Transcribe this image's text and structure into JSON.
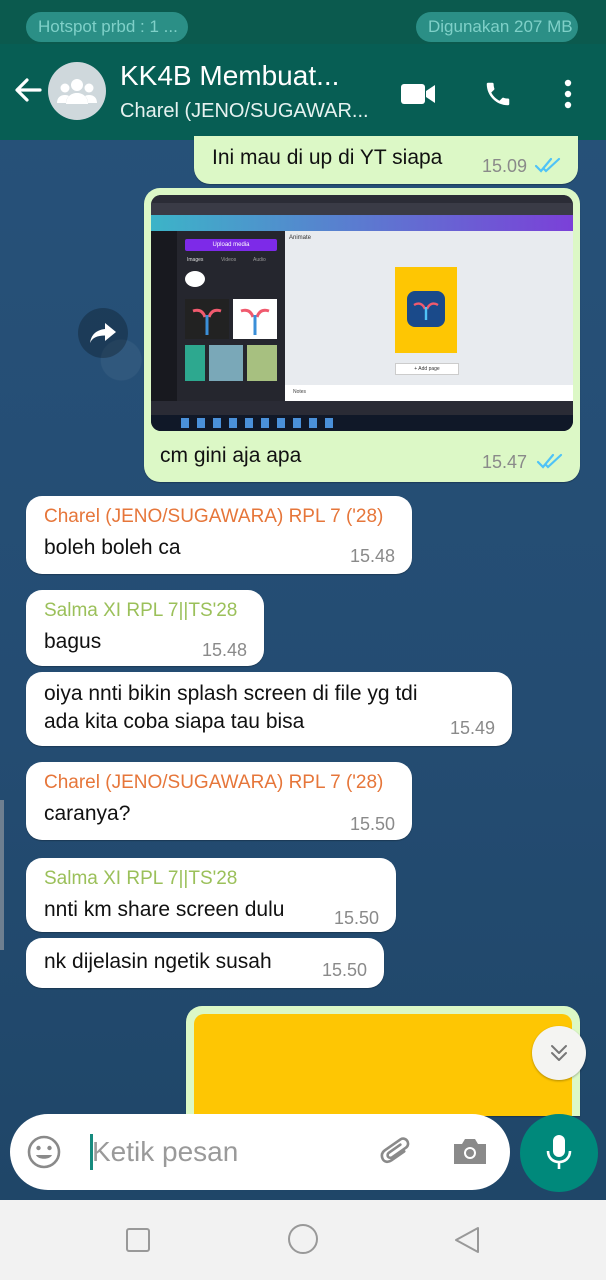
{
  "status": {
    "hotspot": "Hotspot prbd : 1 ...",
    "usage": "Digunakan 207 MB"
  },
  "header": {
    "title": "KK4B Membuat...",
    "subtitle": "Charel (JENO/SUGAWAR..."
  },
  "colors": {
    "header": "#075e54",
    "outgoing": "#dcf8c6",
    "incoming": "#ffffff",
    "accent": "#00897b",
    "sender_orange": "#e6763a",
    "sender_green": "#9bc05a",
    "read_ticks": "#4fc3f7"
  },
  "messages": {
    "m1": {
      "text": "Ini mau di up di YT siapa",
      "time": "15.09"
    },
    "m2": {
      "caption": "cm gini aja apa",
      "time": "15.47"
    },
    "m3": {
      "sender": "Charel (JENO/SUGAWARA) RPL 7 ('28)",
      "text": "boleh boleh ca",
      "time": "15.48"
    },
    "m4": {
      "sender": "Salma XI RPL 7||TS'28",
      "text": "bagus",
      "time": "15.48"
    },
    "m5": {
      "line1": "oiya nnti bikin splash screen di file yg tdi",
      "line2": "ada kita coba siapa tau bisa",
      "time": "15.49"
    },
    "m6": {
      "sender": "Charel (JENO/SUGAWARA) RPL 7 ('28)",
      "text": "caranya?",
      "time": "15.50"
    },
    "m7": {
      "sender": "Salma XI RPL 7||TS'28",
      "text": "nnti km share screen dulu",
      "time": "15.50"
    },
    "m8": {
      "text": "nk dijelasin ngetik susah",
      "time": "15.50"
    }
  },
  "screenshot": {
    "upload_label": "Upload media",
    "tabs": [
      "Images",
      "Videos",
      "Audio"
    ],
    "canvas_name": "Animate",
    "add_page": "+ Add page",
    "notes": "Notes"
  },
  "composer": {
    "placeholder": "Ketik pesan"
  },
  "icons": [
    "back-arrow-icon",
    "group-avatar-icon",
    "video-call-icon",
    "phone-icon",
    "more-vert-icon",
    "forward-icon",
    "double-check-icon",
    "scroll-down-icon",
    "emoji-icon",
    "attach-icon",
    "camera-icon",
    "mic-icon",
    "nav-recent-icon",
    "nav-home-icon",
    "nav-back-icon"
  ]
}
